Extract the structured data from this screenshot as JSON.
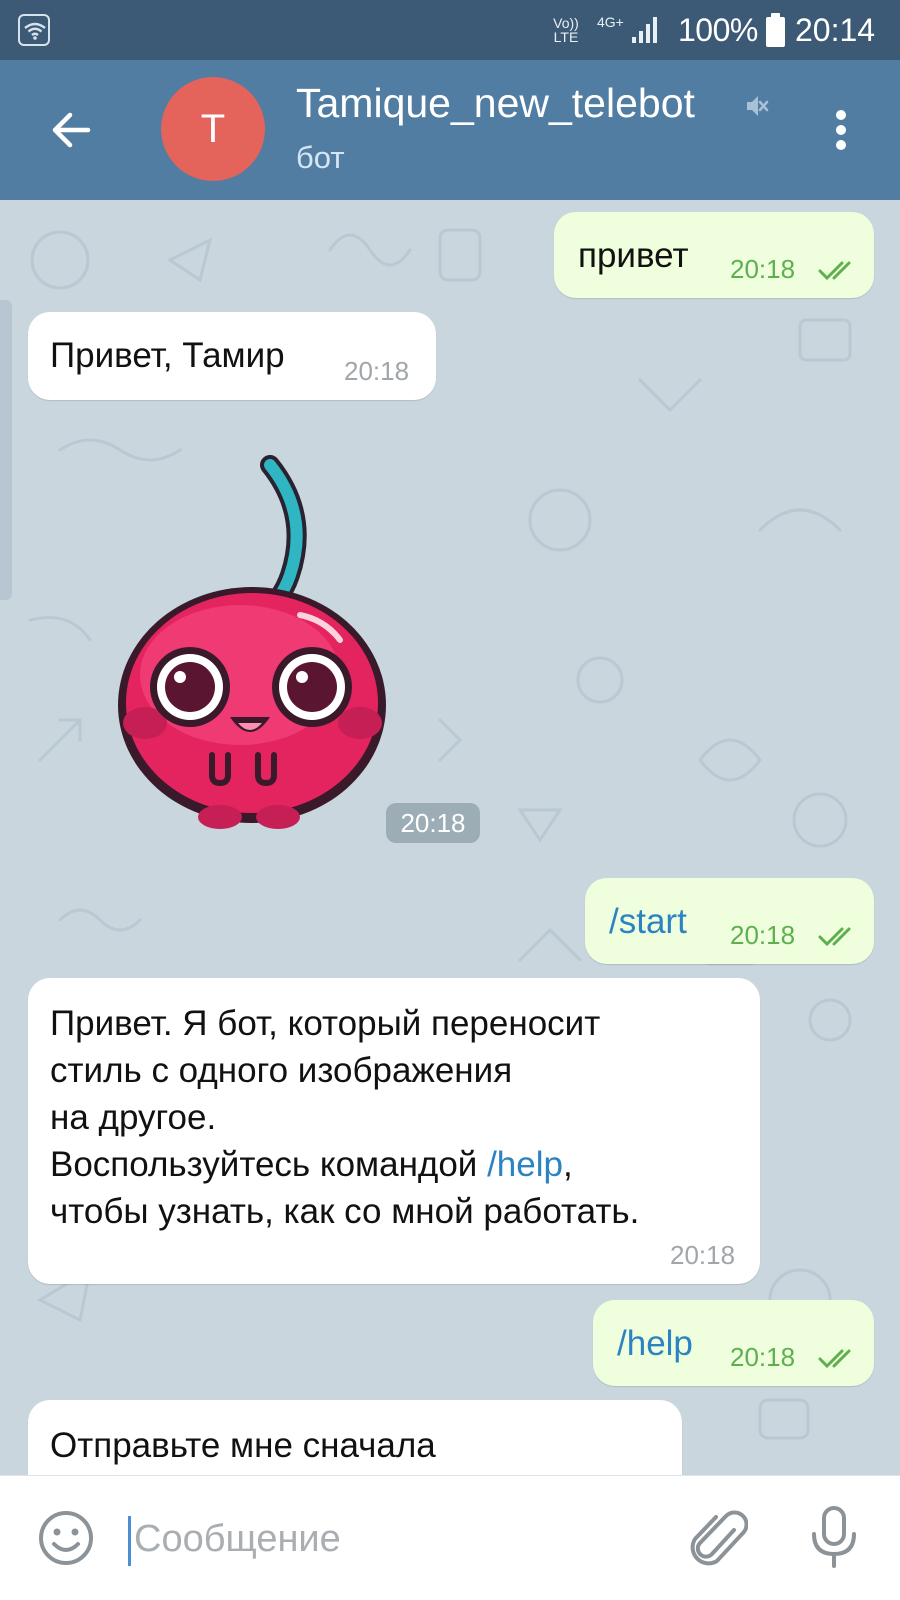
{
  "status_bar": {
    "volte": "Vo)) LTE",
    "network": "4G+",
    "battery": "100%",
    "clock": "20:14"
  },
  "header": {
    "avatar_letter": "T",
    "title": "Tamique_new_telebot",
    "subtitle": "бот"
  },
  "messages": [
    {
      "dir": "out",
      "text": "привет",
      "time": "20:18",
      "read": true
    },
    {
      "dir": "in",
      "text": "Привет, Тамир",
      "time": "20:18"
    },
    {
      "dir": "in",
      "type": "sticker",
      "sticker": "cherry-character",
      "time": "20:18"
    },
    {
      "dir": "out",
      "text": "/start",
      "time": "20:18",
      "read": true
    },
    {
      "dir": "in",
      "lines": [
        "Привет. Я бот, который переносит",
        "стиль с одного изображения",
        "на другое.",
        "Воспользуйтесь командой ",
        "/help",
        ",",
        "чтобы узнать, как со мной работать."
      ],
      "time": "20:18"
    },
    {
      "dir": "out",
      "text": "/help",
      "time": "20:18",
      "read": true
    },
    {
      "dir": "in",
      "text": "Отправьте мне сначала",
      "partial": true
    }
  ],
  "composer": {
    "placeholder": "Сообщение"
  },
  "colors": {
    "status_bar": "#3c5a76",
    "header": "#527da3",
    "avatar": "#e4635a",
    "outgoing_bubble": "#effedd",
    "incoming_bubble": "#ffffff",
    "link": "#2c83c4",
    "read_ticks": "#5eb04f",
    "wallpaper": "#c9d6de"
  },
  "icons": [
    "wifi-icon",
    "signal-icon",
    "battery-icon",
    "back-arrow-icon",
    "mute-icon",
    "more-vert-icon",
    "double-check-icon",
    "emoji-icon",
    "paperclip-icon",
    "microphone-icon"
  ]
}
